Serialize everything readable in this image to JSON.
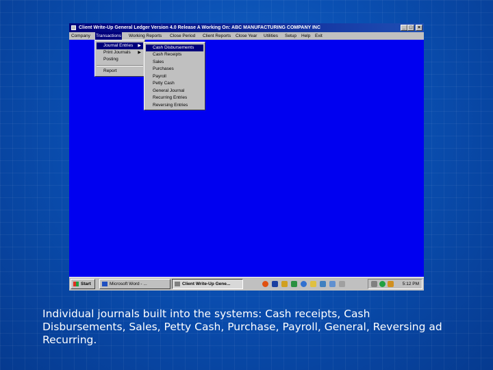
{
  "window": {
    "title": "Client Write-Up General Ledger   Version 4.0 Release A     Working On:   ABC MANUFACTURING COMPANY INC",
    "minimize": "_",
    "maximize": "□",
    "close": "×"
  },
  "menubar": {
    "items": [
      "Company",
      "Transactions",
      "Working Reports",
      "Close Period",
      "Client Reports",
      "Close Year",
      "Utilities",
      "Setup",
      "Help",
      "Exit"
    ],
    "active": "Transactions"
  },
  "transactions_menu": {
    "items": [
      "Journal Entries",
      "Print Journals",
      "Posting"
    ],
    "report": "Report",
    "highlighted": "Journal Entries"
  },
  "journal_submenu": {
    "items": [
      "Cash Disbursements",
      "Cash Receipts",
      "Sales",
      "Purchases",
      "Payroll",
      "Petty Cash",
      "General Journal",
      "Recurring Entries",
      "Reversing Entries"
    ],
    "highlighted": "Cash Disbursements"
  },
  "taskbar": {
    "start": "Start",
    "tasks": [
      "Microsoft Word - ...",
      "Client Write-Up Gene..."
    ],
    "clock": "5:12 PM"
  },
  "caption": "Individual journals built into the systems: Cash receipts, Cash Disbursements, Sales, Petty Cash, Purchase, Payroll, General, Reversing ad Recurring.",
  "colors": {
    "slide_bg": "#0a4fb2",
    "desktop": "#0000f0",
    "titlebar": "#00007b",
    "menu_face": "#c0c0c0",
    "highlight": "#00007b"
  }
}
